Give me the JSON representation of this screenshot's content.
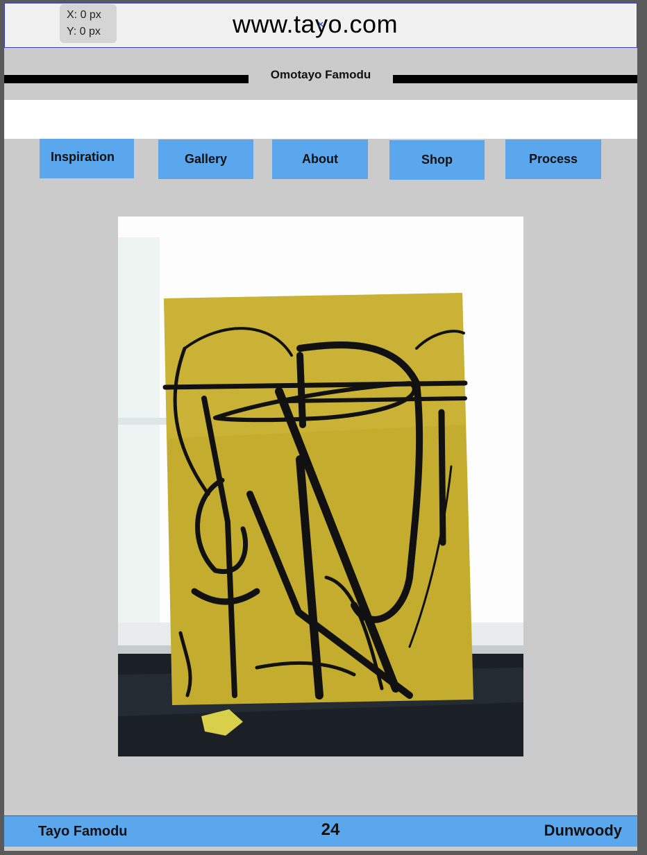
{
  "browser": {
    "url": "www.tayo.com",
    "coords": {
      "x_label": "X: 0 px",
      "y_label": "Y: 0 px"
    }
  },
  "header": {
    "site_name": "Omotayo Famodu"
  },
  "nav": {
    "items": [
      {
        "label": "Inspiration"
      },
      {
        "label": "Gallery"
      },
      {
        "label": "About"
      },
      {
        "label": "Shop"
      },
      {
        "label": "Process"
      }
    ]
  },
  "main": {
    "artwork": {
      "description": "yellow-abstract-painting"
    }
  },
  "footer": {
    "left": "Tayo Famodu",
    "center": "24",
    "right": "Dunwoody"
  },
  "colors": {
    "nav_bg": "#5aa7ee",
    "page_bg": "#cbcbcb",
    "painting_yellow": "#c4ad2e"
  }
}
